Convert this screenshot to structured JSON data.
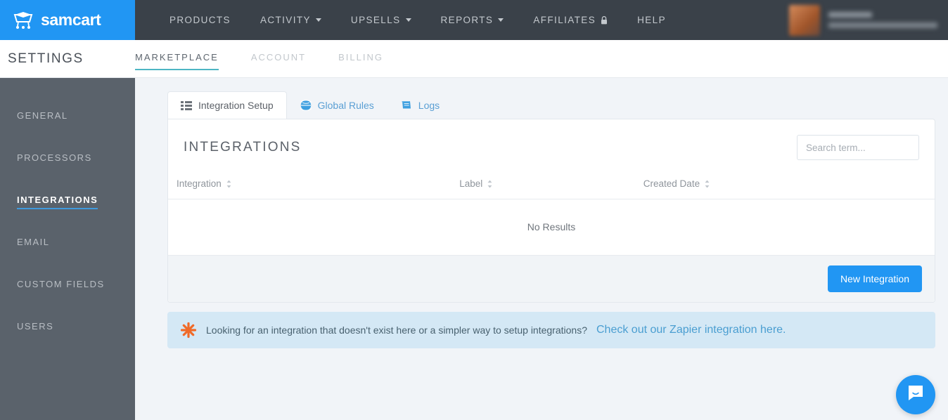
{
  "brand": {
    "name": "samcart",
    "logo_icon": "shopping-cart-icon",
    "accent_blue": "#2196f3",
    "nav_bg": "#3a4149",
    "sidebar_bg": "#5a626b",
    "teal_underline": "#4db6c4"
  },
  "topnav": {
    "items": [
      {
        "label": "PRODUCTS",
        "has_caret": false,
        "has_lock": false
      },
      {
        "label": "ACTIVITY",
        "has_caret": true,
        "has_lock": false
      },
      {
        "label": "UPSELLS",
        "has_caret": true,
        "has_lock": false
      },
      {
        "label": "REPORTS",
        "has_caret": true,
        "has_lock": false
      },
      {
        "label": "AFFILIATES",
        "has_caret": false,
        "has_lock": true
      },
      {
        "label": "HELP",
        "has_caret": false,
        "has_lock": false
      }
    ],
    "user": {
      "avatar_icon": "user-avatar",
      "name_redacted": true,
      "email_redacted": true
    }
  },
  "settings": {
    "title": "SETTINGS",
    "tabs": [
      {
        "label": "MARKETPLACE",
        "active": true
      },
      {
        "label": "ACCOUNT",
        "active": false
      },
      {
        "label": "BILLING",
        "active": false
      }
    ]
  },
  "sidebar": {
    "items": [
      {
        "label": "GENERAL",
        "active": false
      },
      {
        "label": "PROCESSORS",
        "active": false
      },
      {
        "label": "INTEGRATIONS",
        "active": true
      },
      {
        "label": "EMAIL",
        "active": false
      },
      {
        "label": "CUSTOM FIELDS",
        "active": false
      },
      {
        "label": "USERS",
        "active": false
      }
    ]
  },
  "card_tabs": [
    {
      "label": "Integration Setup",
      "icon": "list-icon",
      "active": true
    },
    {
      "label": "Global Rules",
      "icon": "globe-icon",
      "active": false
    },
    {
      "label": "Logs",
      "icon": "book-icon",
      "active": false
    }
  ],
  "panel": {
    "title": "INTEGRATIONS",
    "search": {
      "value": "",
      "placeholder": "Search term..."
    },
    "table": {
      "columns": [
        {
          "label": "Integration",
          "sortable": true
        },
        {
          "label": "Label",
          "sortable": true
        },
        {
          "label": "Created Date",
          "sortable": true
        }
      ],
      "rows": [],
      "empty_message": "No Results"
    },
    "footer": {
      "new_integration_label": "New Integration"
    }
  },
  "notice": {
    "icon": "zapier-icon",
    "text": "Looking for an integration that doesn't exist here or a simpler way to setup integrations?",
    "link_text": "Check out our Zapier integration here."
  },
  "chat": {
    "icon": "chat-bubble-icon"
  }
}
